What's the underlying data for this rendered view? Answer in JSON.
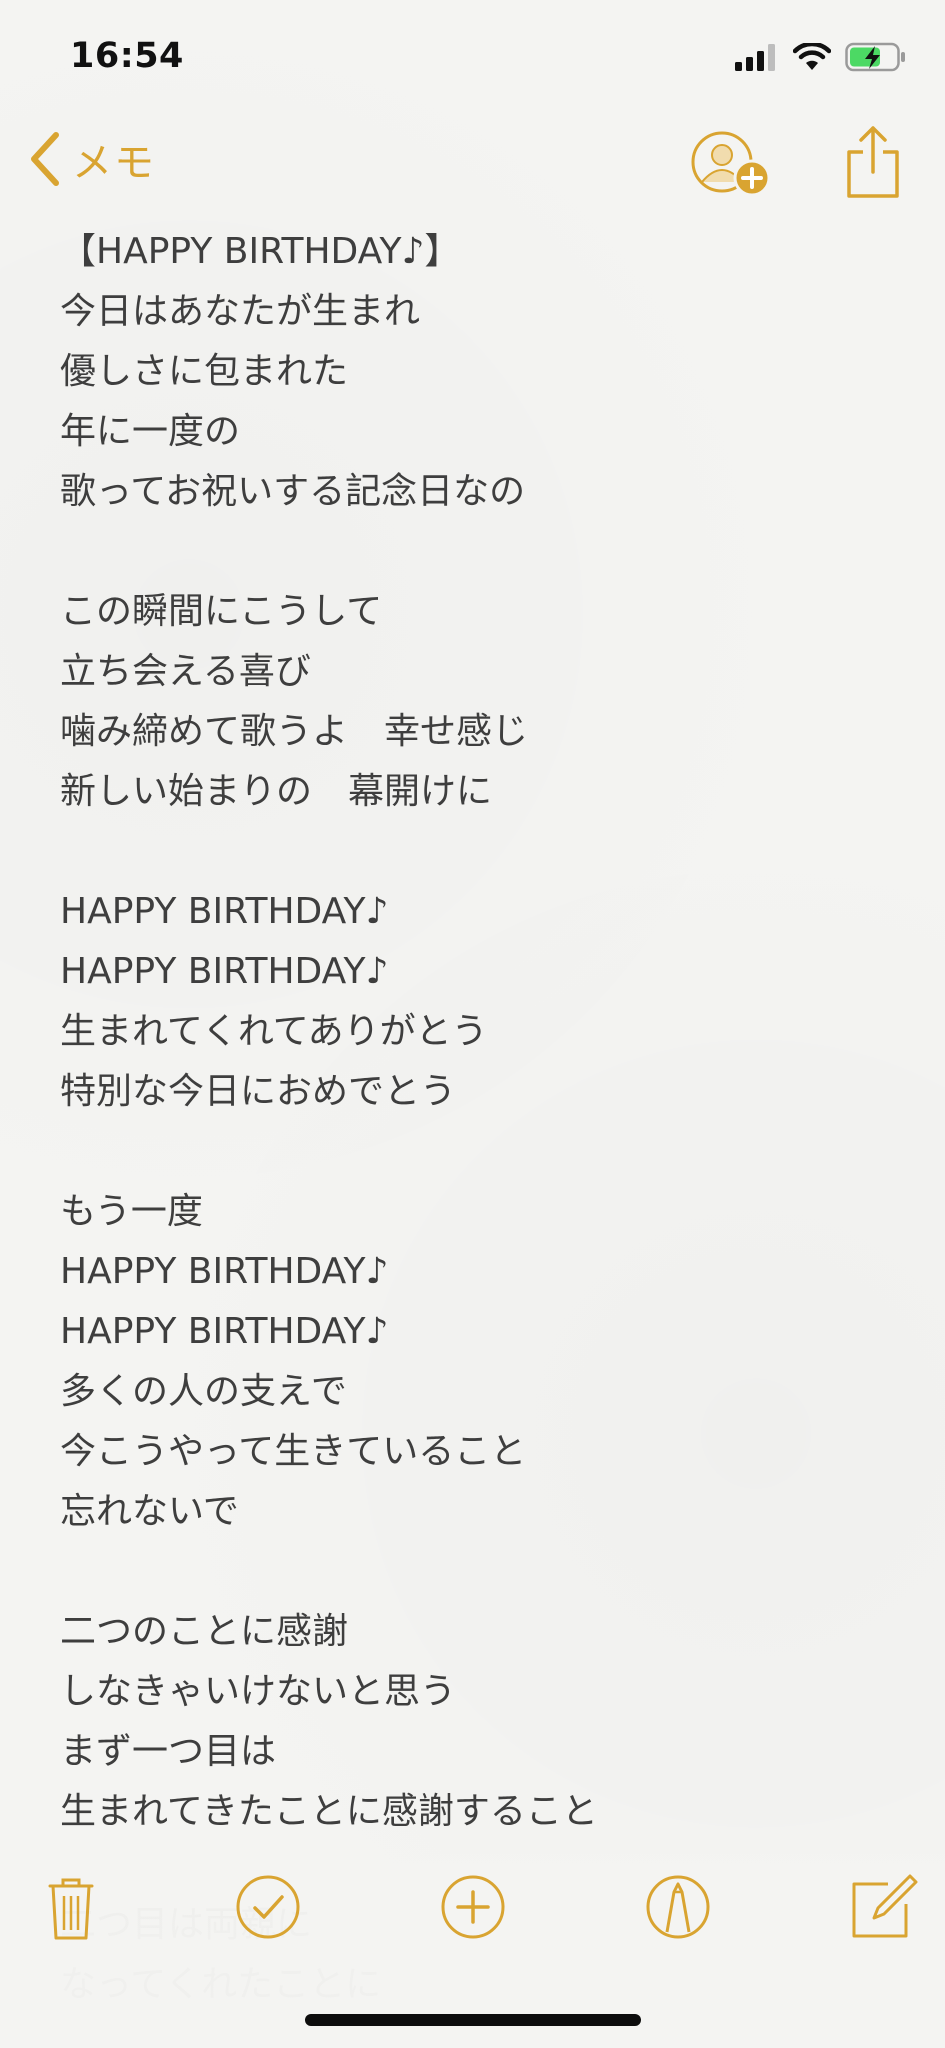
{
  "status_bar": {
    "time": "16:54",
    "icons": [
      "signal-icon",
      "wifi-icon",
      "battery-charging-icon"
    ]
  },
  "nav": {
    "back_label": "メモ",
    "back_icon": "chevron-left-icon",
    "add_person_icon": "add-person-icon",
    "share_icon": "share-icon"
  },
  "note": {
    "lines": [
      "【HAPPY BIRTHDAY♪】",
      "今日はあなたが生まれ",
      "優しさに包まれた",
      "年に一度の",
      "歌ってお祝いする記念日なの",
      "",
      "この瞬間にこうして",
      "立ち会える喜び",
      "噛み締めて歌うよ　幸せ感じ",
      "新しい始まりの　幕開けに",
      "",
      "HAPPY BIRTHDAY♪",
      "HAPPY BIRTHDAY♪",
      "生まれてくれてありがとう",
      "特別な今日におめでとう",
      "",
      "もう一度",
      "HAPPY BIRTHDAY♪",
      "HAPPY BIRTHDAY♪",
      "多くの人の支えで",
      "今こうやって生きていること",
      "忘れないで",
      "",
      "二つのことに感謝",
      "しなきゃいけないと思う",
      "まず一つ目は",
      "生まれてきたことに感謝すること"
    ],
    "faded_lines": [
      "二つ目は両親に",
      "なってくれたことに"
    ]
  },
  "toolbar": {
    "items": [
      "trash-icon",
      "checklist-icon",
      "add-icon",
      "markup-icon",
      "compose-icon"
    ]
  },
  "colors": {
    "accent": "#d9a431",
    "text": "#3e3e3e",
    "background": "#f4f4f2"
  }
}
